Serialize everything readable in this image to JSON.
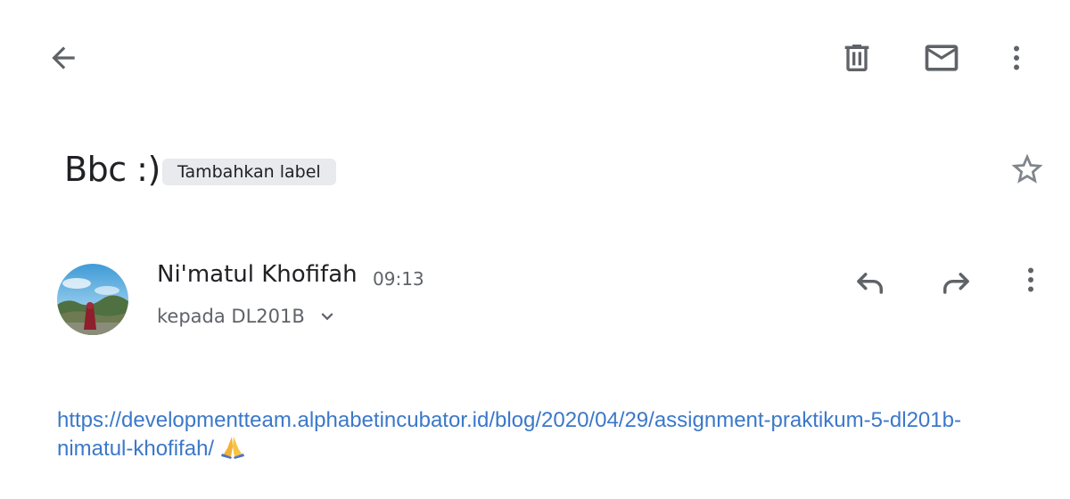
{
  "toolbar": {
    "back_icon": "arrow-back-icon",
    "delete_icon": "trash-icon",
    "mark_unread_icon": "mail-icon",
    "more_icon": "more-vert-icon"
  },
  "subject": {
    "title": "Bbc :)",
    "add_label": "Tambahkan label",
    "star_icon": "star-outline-icon"
  },
  "message": {
    "sender": "Ni'matul Khofifah",
    "time": "09:13",
    "recipient": "kepada DL201B",
    "reply_icon": "reply-icon",
    "forward_icon": "forward-icon",
    "more_icon": "more-vert-icon",
    "body_link": "https://developmentteam.alphabetincubator.id/blog/2020/04/29/assignment-praktikum-5-dl201b-nimatul-khofifah/",
    "body_emoji_icon": "folded-hands-emoji"
  },
  "colors": {
    "link": "#3b78c9",
    "icon": "#5f6368",
    "chip_bg": "#e8eaed"
  }
}
